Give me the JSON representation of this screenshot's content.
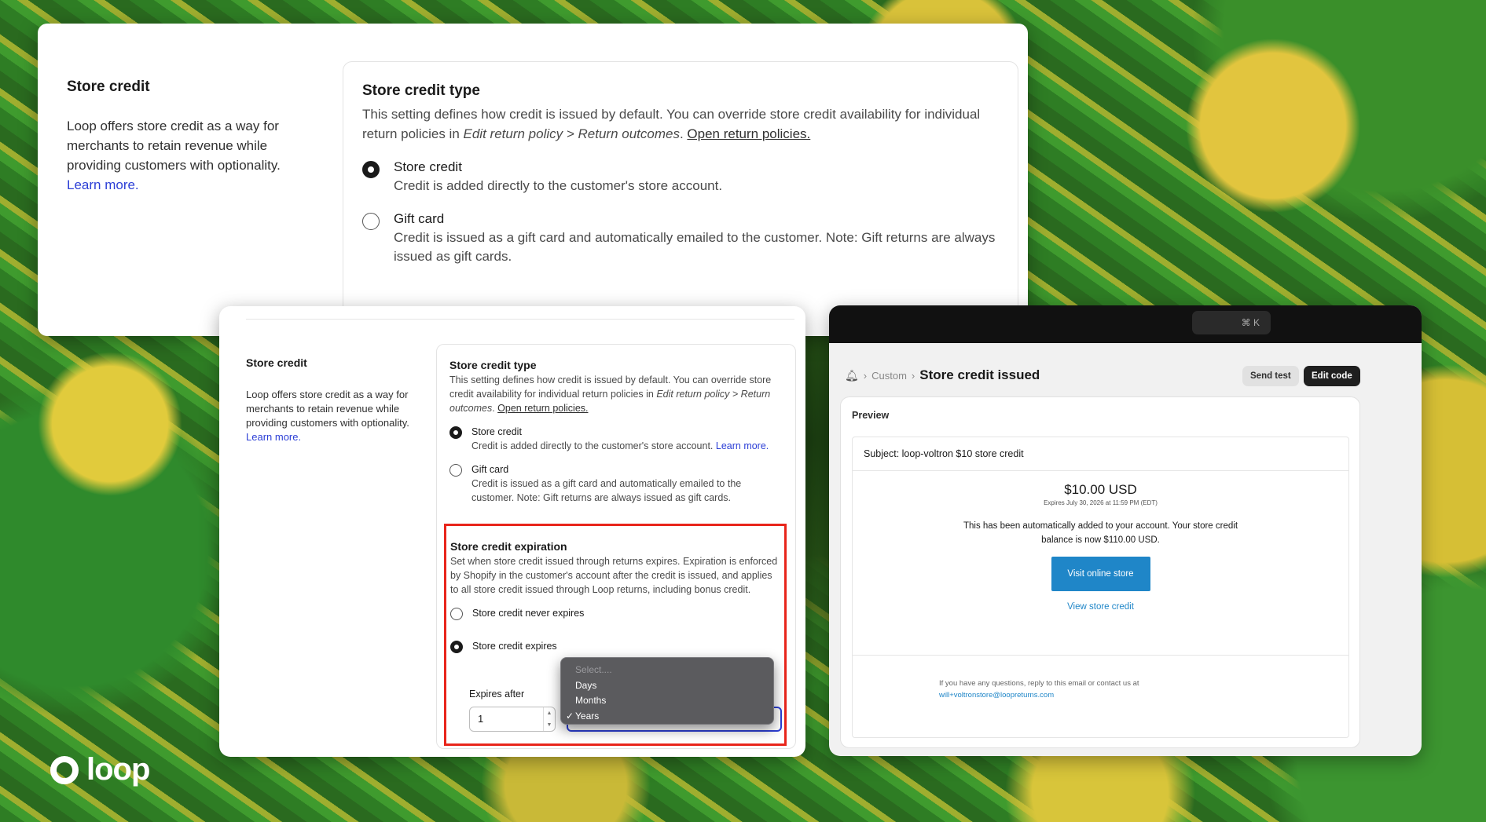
{
  "panel1": {
    "left_title": "Store credit",
    "left_text": "Loop offers store credit as a way for merchants to retain revenue while providing customers with optionality.",
    "learn_more": "Learn more.",
    "card_title": "Store credit type",
    "desc_a": "This setting defines how credit is issued by default. You can override store credit availability for individual return policies in ",
    "desc_italic": "Edit return policy > Return outcomes",
    "desc_b": ". ",
    "desc_link": "Open return policies.",
    "opt1_title": "Store credit",
    "opt1_desc": "Credit is added directly to the customer's store account.",
    "opt2_title": "Gift card",
    "opt2_desc": "Credit is issued as a gift card and automatically emailed to the customer. Note: Gift returns are always issued as gift cards."
  },
  "panel2": {
    "left_title": "Store credit",
    "left_text": "Loop offers store credit as a way for merchants to retain revenue while providing customers with optionality.",
    "learn_more": "Learn more.",
    "card_title": "Store credit type",
    "desc_a": "This setting defines how credit is issued by default. You can override store credit availability for individual return policies in ",
    "desc_italic": "Edit return policy > Return outcomes",
    "desc_b": ". ",
    "desc_link": "Open return policies.",
    "opt1_title": "Store credit",
    "opt1_desc": "Credit is added directly to the customer's store account. ",
    "opt1_link": "Learn more.",
    "opt2_title": "Gift card",
    "opt2_desc": "Credit is issued as a gift card and automatically emailed to the customer. Note: Gift returns are always issued as gift cards.",
    "exp_title": "Store credit expiration",
    "exp_desc": "Set when store credit issued through returns expires. Expiration is enforced by Shopify in the customer's account after the credit is issued, and applies to all store credit issued through Loop returns, including bonus credit.",
    "never_label": "Store credit never expires",
    "expires_label": "Store credit expires",
    "expires_after_label": "Expires after",
    "expires_after_value": "1",
    "dropdown": {
      "placeholder": "Select....",
      "options": [
        "Days",
        "Months",
        "Years"
      ],
      "selected": "Years",
      "check": "✓"
    }
  },
  "panel3": {
    "kbd": "⌘  K",
    "crumb_1": "Custom",
    "crumb_sep": "›",
    "title": "Store credit issued",
    "send_test": "Send test",
    "edit_code": "Edit code",
    "preview_label": "Preview",
    "subject": "Subject: loop-voltron $10 store credit",
    "amount": "$10.00 USD",
    "expires": "Expires July 30, 2026 at 11:59 PM (EDT)",
    "message": "This has been automatically added to your account. Your store credit balance is now $110.00 USD.",
    "visit_button": "Visit online store",
    "view_link": "View store credit",
    "footer_text": "If you have any questions, reply to this email or contact us at",
    "footer_email": "will+voltronstore@loopreturns.com"
  },
  "brand": {
    "logo_text": "loop"
  },
  "colors": {
    "link": "#2c3fd6",
    "highlight": "#e8251b",
    "email_button": "#1f86c8"
  }
}
